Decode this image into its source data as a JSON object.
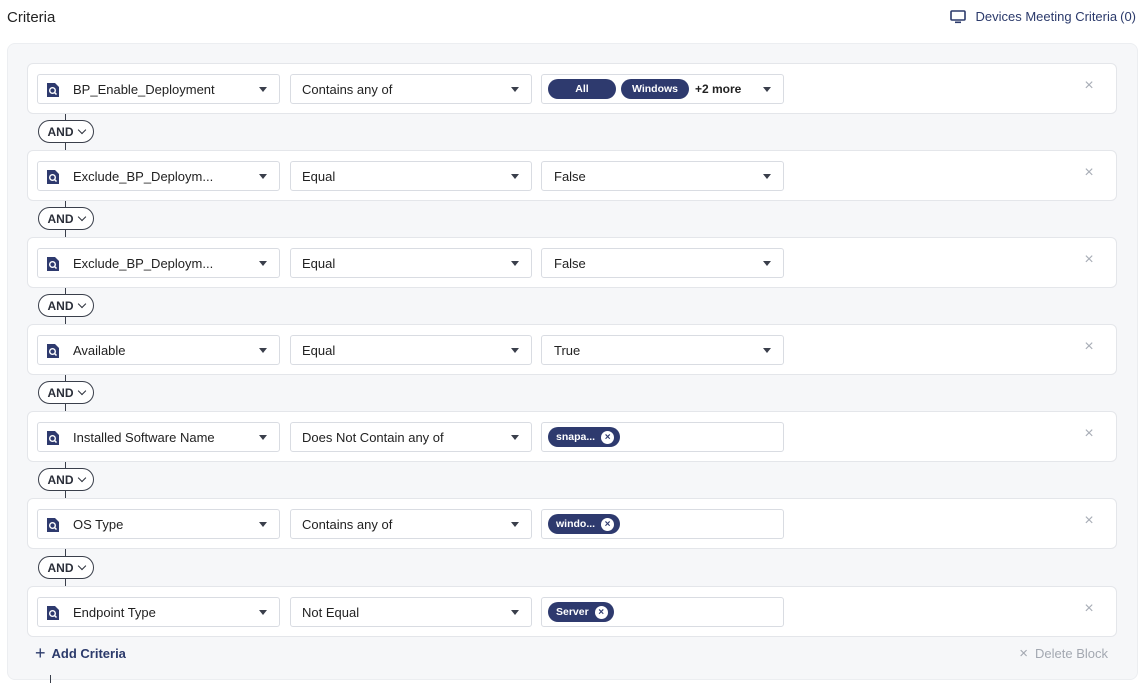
{
  "header": {
    "title": "Criteria",
    "devices_label": "Devices Meeting Criteria",
    "devices_count": "(0)"
  },
  "connector_label": "AND",
  "rows": [
    {
      "field": "BP_Enable_Deployment",
      "operator": "Contains any of",
      "chips": [
        "All",
        "Windows"
      ],
      "more": "+2 more"
    },
    {
      "field": "Exclude_BP_Deploym...",
      "operator": "Equal",
      "value": "False"
    },
    {
      "field": "Exclude_BP_Deploym...",
      "operator": "Equal",
      "value": "False"
    },
    {
      "field": "Available",
      "operator": "Equal",
      "value": "True"
    },
    {
      "field": "Installed Software Name",
      "operator": "Does Not Contain any of",
      "chip": "snapa..."
    },
    {
      "field": "OS Type",
      "operator": "Contains any of",
      "chip": "windo..."
    },
    {
      "field": "Endpoint Type",
      "operator": "Not Equal",
      "chip": "Server"
    }
  ],
  "footer": {
    "add_label": "Add Criteria",
    "delete_label": "Delete Block"
  },
  "icons": {
    "field": "field-search-icon",
    "close": "close-icon",
    "monitor": "monitor-icon"
  },
  "colors": {
    "accent": "#2e3a6e",
    "muted": "#a3a8b1"
  }
}
